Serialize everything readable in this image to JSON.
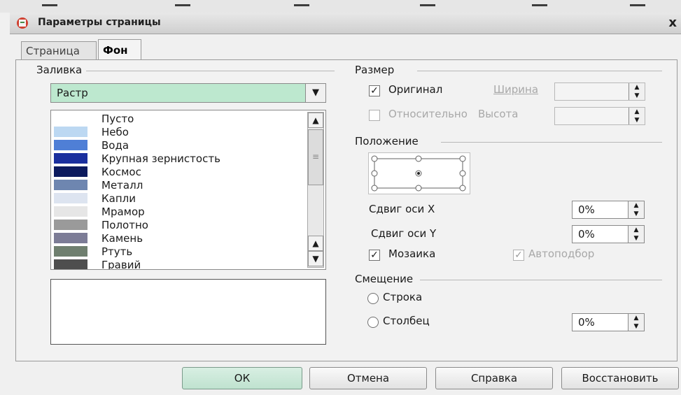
{
  "window": {
    "title": "Параметры страницы",
    "close_glyph": "x"
  },
  "tabs": [
    {
      "label": "Страница",
      "active": false
    },
    {
      "label": "Фон",
      "active": true
    }
  ],
  "fill": {
    "group_label": "Заливка",
    "type_value": "Растр",
    "items": [
      {
        "label": "Пусто",
        "color": "#ffffff"
      },
      {
        "label": "Небо",
        "color": "#bcd8f2"
      },
      {
        "label": "Вода",
        "color": "#4f7fd6"
      },
      {
        "label": "Крупная зернистость",
        "color": "#1a2f9e"
      },
      {
        "label": "Космос",
        "color": "#0c1a5e"
      },
      {
        "label": "Металл",
        "color": "#6e86b0"
      },
      {
        "label": "Капли",
        "color": "#dde4f0"
      },
      {
        "label": "Мрамор",
        "color": "#e6e6e6"
      },
      {
        "label": "Полотно",
        "color": "#9a9a9a"
      },
      {
        "label": "Камень",
        "color": "#7c7c96"
      },
      {
        "label": "Ртуть",
        "color": "#6f7f6f"
      },
      {
        "label": "Гравий",
        "color": "#4e4e4e"
      }
    ]
  },
  "size": {
    "group_label": "Размер",
    "original_label": "Оригинал",
    "original_checked": true,
    "width_label": "Ширина",
    "relative_label": "Относительно",
    "height_label": "Высота"
  },
  "position": {
    "group_label": "Положение",
    "shift_x_label": "Сдвиг оси X",
    "shift_x_value": "0%",
    "shift_y_label": "Сдвиг оси Y",
    "shift_y_value": "0%",
    "tile_label": "Мозаика",
    "tile_checked": true,
    "autofit_label": "Автоподбор"
  },
  "offset": {
    "group_label": "Смещение",
    "row_label": "Строка",
    "column_label": "Столбец",
    "value": "0%"
  },
  "buttons": {
    "ok": "ОК",
    "cancel": "Отмена",
    "help": "Справка",
    "reset": "Восстановить"
  }
}
